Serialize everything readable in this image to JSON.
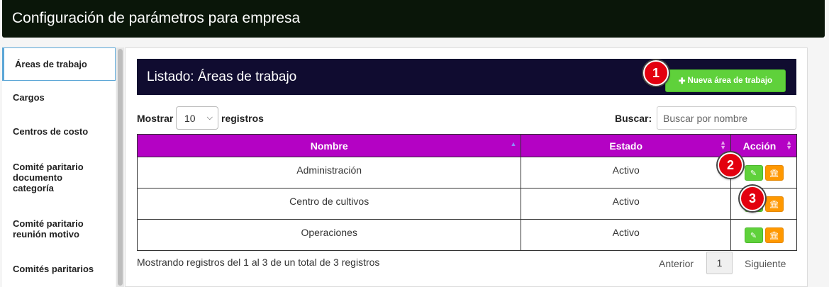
{
  "header": {
    "title": "Configuración de parámetros para empresa"
  },
  "sidebar": {
    "items": [
      {
        "label": "Áreas de trabajo"
      },
      {
        "label": "Cargos"
      },
      {
        "label": "Centros de costo"
      },
      {
        "label": "Comité paritario documento categoría"
      },
      {
        "label": "Comité paritario reunión motivo"
      },
      {
        "label": "Comités paritarios"
      }
    ]
  },
  "listing": {
    "title": "Listado: Áreas de trabajo",
    "new_button": "Nueva área de trabajo",
    "new_icon": "plus-icon"
  },
  "controls": {
    "show_label": "Mostrar",
    "show_value": "10",
    "records_label": "registros",
    "search_label": "Buscar:",
    "search_placeholder": "Buscar por nombre"
  },
  "table": {
    "columns": [
      "Nombre",
      "Estado",
      "Acción"
    ],
    "rows": [
      {
        "nombre": "Administración",
        "estado": "Activo"
      },
      {
        "nombre": "Centro de cultivos",
        "estado": "Activo"
      },
      {
        "nombre": "Operaciones",
        "estado": "Activo"
      }
    ]
  },
  "footer": {
    "info": "Mostrando registros del 1 al 3 de un total de 3 registros",
    "prev": "Anterior",
    "page": "1",
    "next": "Siguiente"
  },
  "annotations": [
    "1",
    "2",
    "3"
  ],
  "colors": {
    "header_bg": "#0a1609",
    "listbar_bg": "#100c30",
    "table_header_bg": "#b402c4",
    "green_button": "#5fd13b",
    "orange_button": "#ff9800",
    "badge_red": "#e3000f"
  }
}
